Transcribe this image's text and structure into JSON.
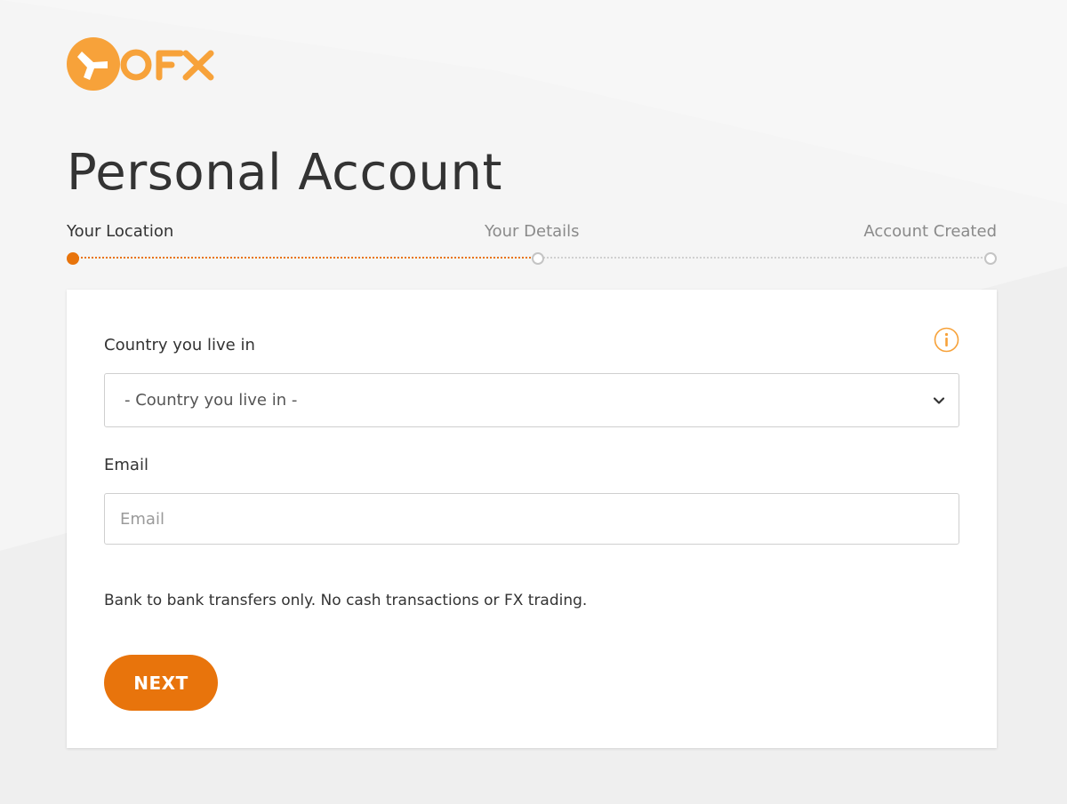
{
  "brand": {
    "name": "OFX",
    "accent_color": "#e8740c",
    "logo_color": "#f7a23a"
  },
  "page": {
    "title": "Personal Account"
  },
  "steps": [
    {
      "label": "Your Location",
      "state": "active"
    },
    {
      "label": "Your Details",
      "state": "inactive"
    },
    {
      "label": "Account Created",
      "state": "inactive"
    }
  ],
  "form": {
    "country": {
      "label": "Country you live in",
      "selected": "- Country you live in -",
      "info_icon": "info-icon"
    },
    "email": {
      "label": "Email",
      "placeholder": "Email",
      "value": ""
    },
    "disclaimer": "Bank to bank transfers only. No cash transactions or FX trading.",
    "next_label": "NEXT"
  }
}
